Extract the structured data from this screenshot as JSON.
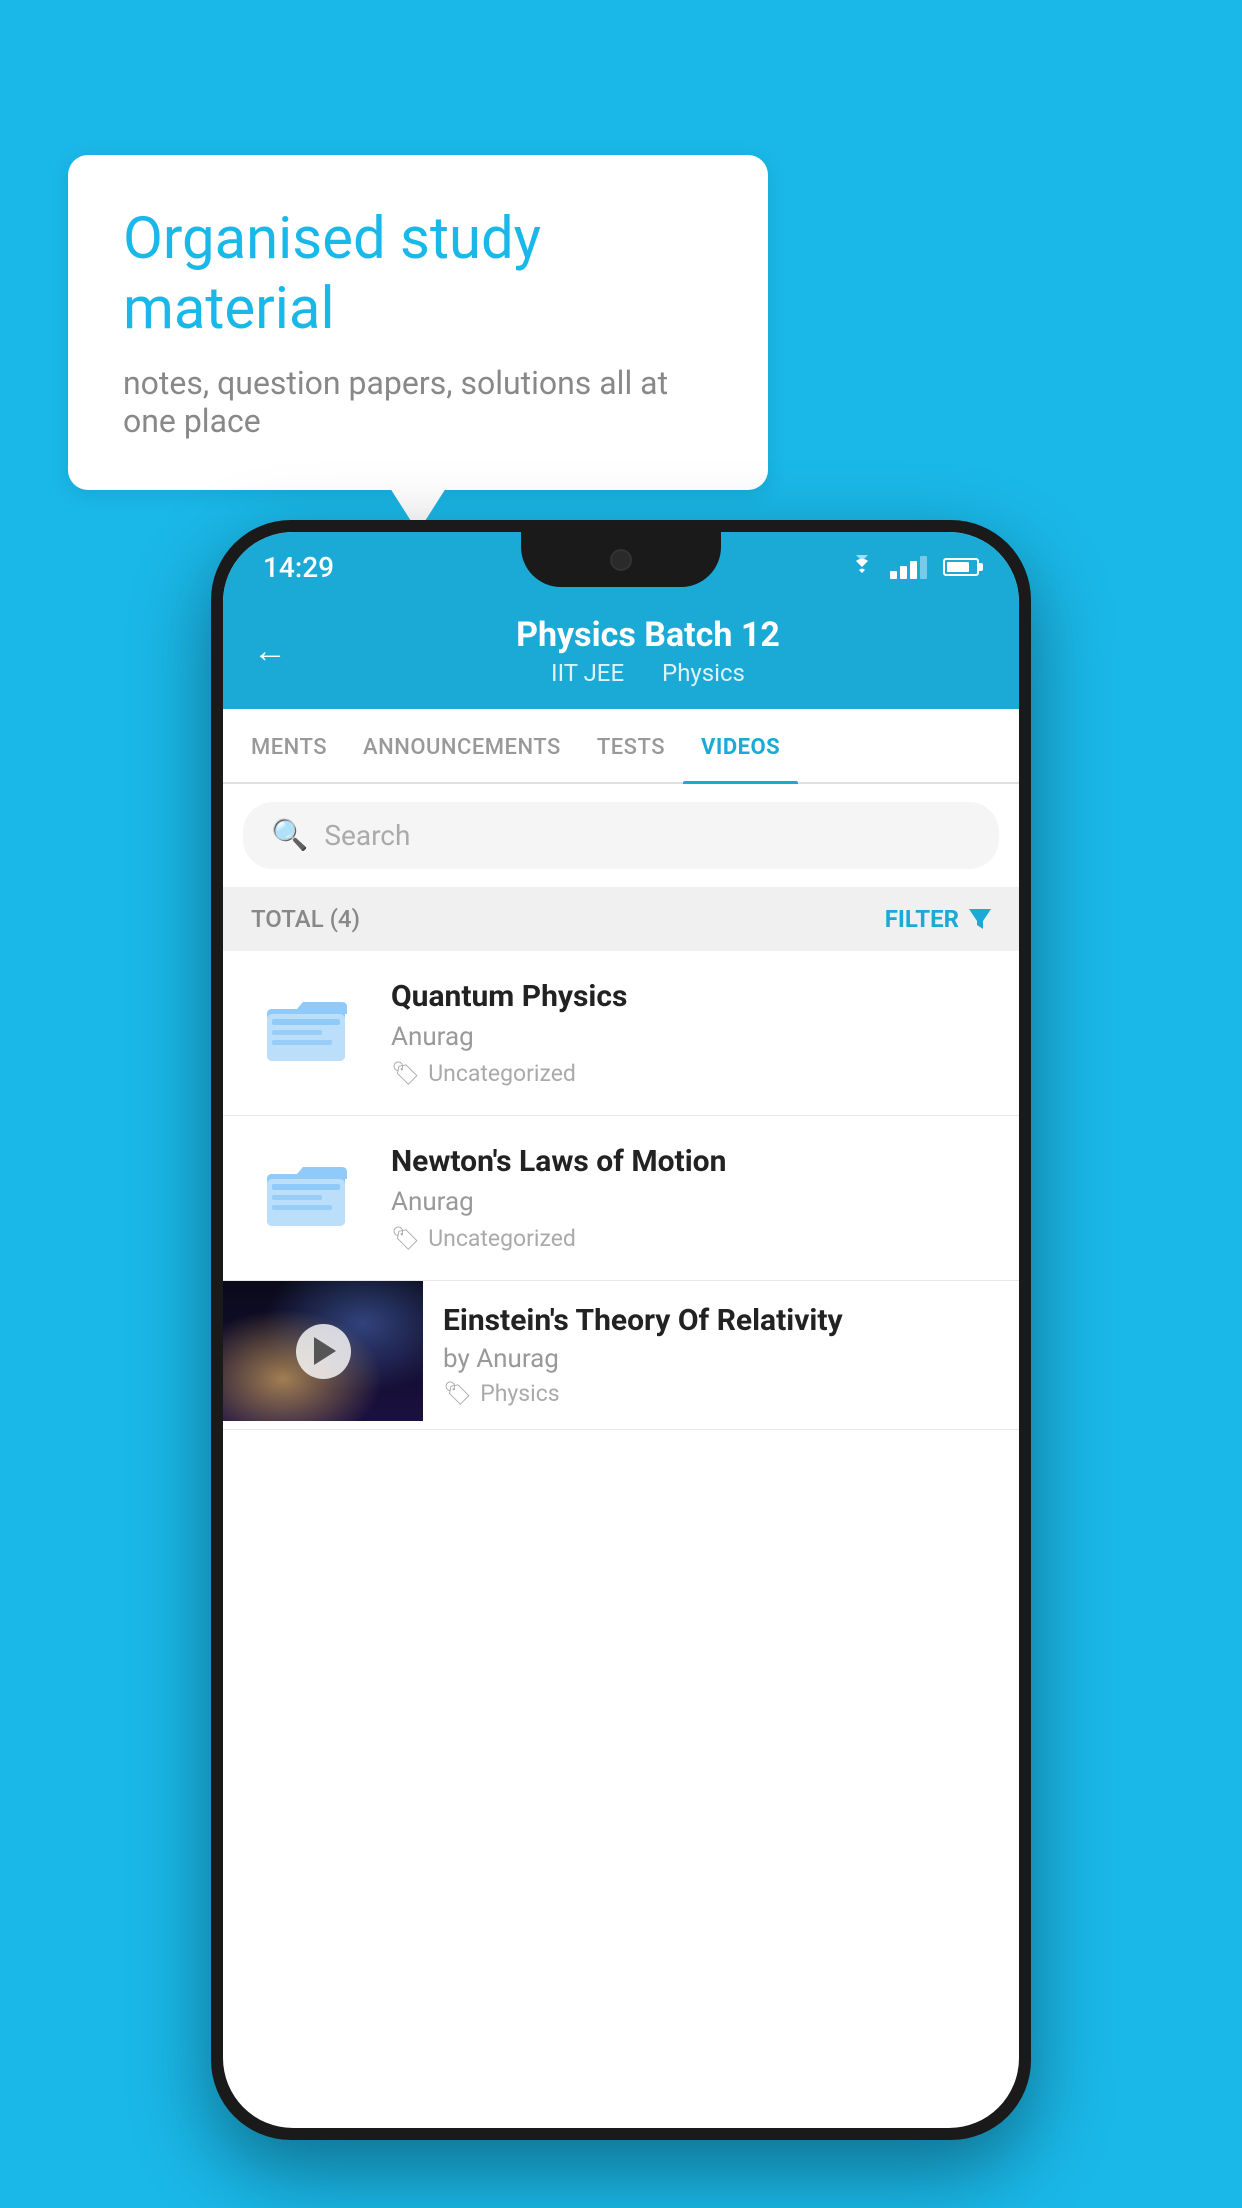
{
  "background_color": "#1ab8e8",
  "speech_bubble": {
    "title": "Organised study material",
    "subtitle": "notes, question papers, solutions all at one place"
  },
  "phone": {
    "status_bar": {
      "time": "14:29"
    },
    "header": {
      "back_label": "←",
      "title": "Physics Batch 12",
      "subtitle_part1": "IIT JEE",
      "subtitle_part2": "Physics"
    },
    "tabs": [
      {
        "label": "MENTS",
        "active": false
      },
      {
        "label": "ANNOUNCEMENTS",
        "active": false
      },
      {
        "label": "TESTS",
        "active": false
      },
      {
        "label": "VIDEOS",
        "active": true
      }
    ],
    "search": {
      "placeholder": "Search"
    },
    "filter": {
      "total_label": "TOTAL (4)",
      "filter_label": "FILTER"
    },
    "videos": [
      {
        "id": 1,
        "title": "Quantum Physics",
        "author": "Anurag",
        "tag": "Uncategorized",
        "has_thumbnail": false
      },
      {
        "id": 2,
        "title": "Newton's Laws of Motion",
        "author": "Anurag",
        "tag": "Uncategorized",
        "has_thumbnail": false
      },
      {
        "id": 3,
        "title": "Einstein's Theory Of Relativity",
        "author": "by Anurag",
        "tag": "Physics",
        "has_thumbnail": true
      }
    ]
  }
}
